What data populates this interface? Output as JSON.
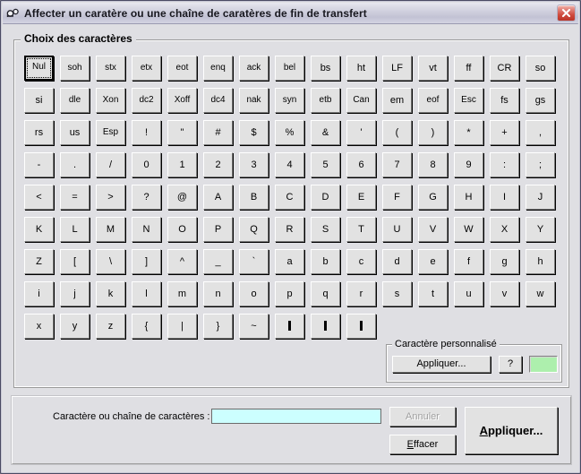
{
  "window": {
    "title": "Affecter un caratère ou une chaîne de caratères de fin de transfert",
    "icon": "transfer-settings-icon",
    "close_label": "×",
    "titlebar_color": "#cdcddc",
    "face_color": "#dfdfe3",
    "close_color": "#cf4a3d"
  },
  "groups": {
    "chars": {
      "label": "Choix des caractères"
    },
    "custom": {
      "label": "Caractère personnalisé",
      "apply_label": "Appliquer...",
      "help_label": "?",
      "preview_value": "",
      "preview_color": "#adefad"
    }
  },
  "keygrid": {
    "focused_key": "Nul",
    "rows": [
      [
        "Nul",
        "soh",
        "stx",
        "etx",
        "eot",
        "enq",
        "ack",
        "bel",
        "bs",
        "ht",
        "LF",
        "vt",
        "ff",
        "CR",
        "so"
      ],
      [
        "si",
        "dle",
        "Xon",
        "dc2",
        "Xoff",
        "dc4",
        "nak",
        "syn",
        "etb",
        "Can",
        "em",
        "eof",
        "Esc",
        "fs",
        "gs"
      ],
      [
        "rs",
        "us",
        "Esp",
        "!",
        "\"",
        "#",
        "$",
        "%",
        "&",
        "'",
        "(",
        ")",
        "*",
        "+",
        ","
      ],
      [
        "-",
        ".",
        "/",
        "0",
        "1",
        "2",
        "3",
        "4",
        "5",
        "6",
        "7",
        "8",
        "9",
        ":",
        ";"
      ],
      [
        "<",
        "=",
        ">",
        "?",
        "@",
        "A",
        "B",
        "C",
        "D",
        "E",
        "F",
        "G",
        "H",
        "I",
        "J"
      ],
      [
        "K",
        "L",
        "M",
        "N",
        "O",
        "P",
        "Q",
        "R",
        "S",
        "T",
        "U",
        "V",
        "W",
        "X",
        "Y"
      ],
      [
        "Z",
        "[",
        "\\",
        "]",
        "^",
        "_",
        "`",
        "a",
        "b",
        "c",
        "d",
        "e",
        "f",
        "g",
        "h"
      ],
      [
        "i",
        "j",
        "k",
        "l",
        "m",
        "n",
        "o",
        "p",
        "q",
        "r",
        "s",
        "t",
        "u",
        "v",
        "w"
      ],
      [
        "x",
        "y",
        "z",
        "{",
        "|",
        "}",
        "~",
        "▮",
        "▮",
        "▮"
      ]
    ]
  },
  "bottom": {
    "field_label": "Caractère ou chaîne de caractères :",
    "input_value": "",
    "input_placeholder": "",
    "input_color": "#ccffff",
    "cancel_label": "Annuler",
    "cancel_enabled": false,
    "erase_label_prefix": "E",
    "erase_label_rest": "ffacer",
    "apply_label_prefix": "A",
    "apply_label_rest": "ppliquer..."
  }
}
